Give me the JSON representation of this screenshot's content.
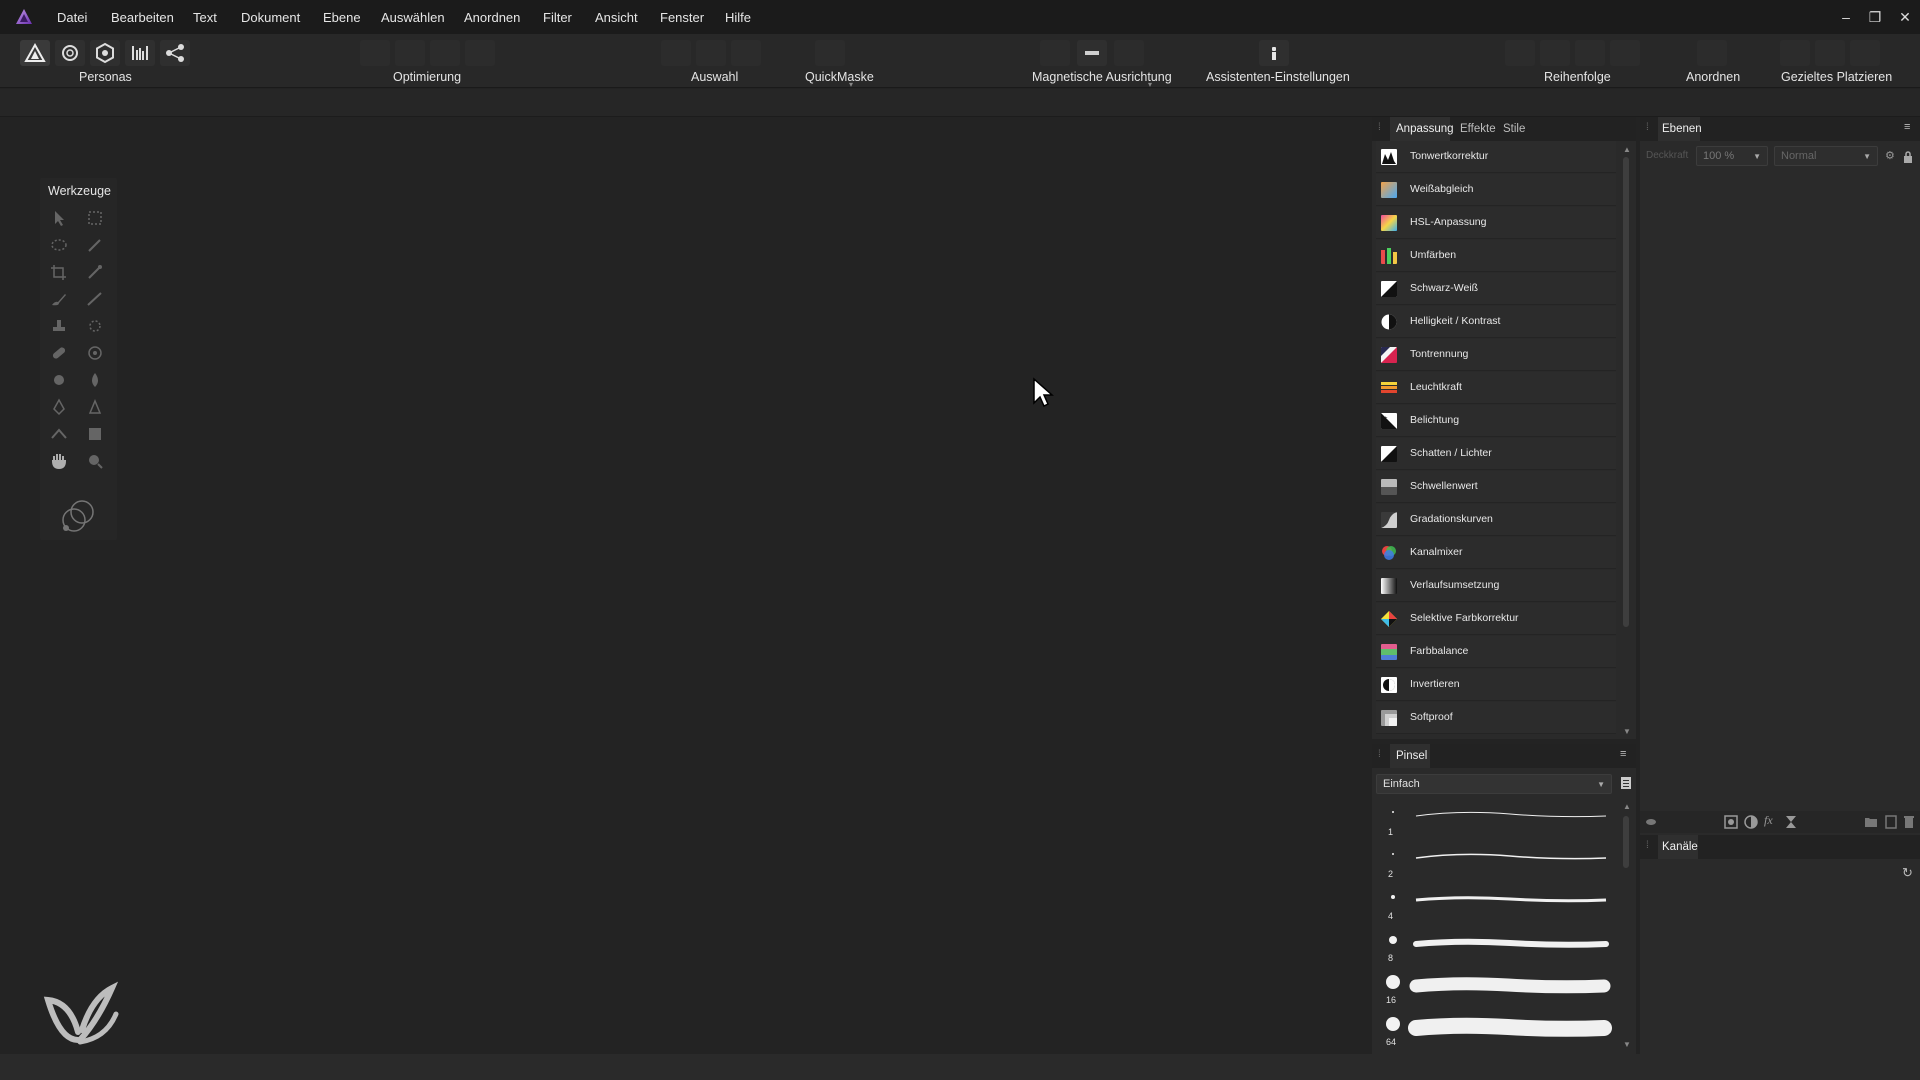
{
  "menubar": {
    "items": [
      "Datei",
      "Bearbeiten",
      "Text",
      "Dokument",
      "Ebene",
      "Auswählen",
      "Anordnen",
      "Filter",
      "Ansicht",
      "Fenster",
      "Hilfe"
    ],
    "window_controls": {
      "minimize": "–",
      "restore": "❐",
      "close": "✕"
    }
  },
  "toolbar": {
    "groups": [
      "Personas",
      "Optimierung",
      "Auswahl",
      "QuickMaske",
      "Magnetische Ausrichtung",
      "Assistenten-Einstellungen",
      "Reihenfolge",
      "Anordnen",
      "Gezieltes Platzieren"
    ]
  },
  "tools_panel": {
    "title": "Werkzeuge"
  },
  "adjustments_panel": {
    "tabs": [
      "Anpassung",
      "Effekte",
      "Stile"
    ],
    "items": [
      {
        "label": "Tonwertkorrektur",
        "icon": "levels-icon"
      },
      {
        "label": "Weißabgleich",
        "icon": "white-balance-icon"
      },
      {
        "label": "HSL-Anpassung",
        "icon": "hsl-icon"
      },
      {
        "label": "Umfärben",
        "icon": "recolor-icon"
      },
      {
        "label": "Schwarz-Weiß",
        "icon": "black-white-icon"
      },
      {
        "label": "Helligkeit / Kontrast",
        "icon": "brightness-contrast-icon"
      },
      {
        "label": "Tontrennung",
        "icon": "posterize-icon"
      },
      {
        "label": "Leuchtkraft",
        "icon": "vibrance-icon"
      },
      {
        "label": "Belichtung",
        "icon": "exposure-icon"
      },
      {
        "label": "Schatten / Lichter",
        "icon": "shadows-highlights-icon"
      },
      {
        "label": "Schwellenwert",
        "icon": "threshold-icon"
      },
      {
        "label": "Gradationskurven",
        "icon": "curves-icon"
      },
      {
        "label": "Kanalmixer",
        "icon": "channel-mixer-icon"
      },
      {
        "label": "Verlaufsumsetzung",
        "icon": "gradient-map-icon"
      },
      {
        "label": "Selektive Farbkorrektur",
        "icon": "selective-color-icon"
      },
      {
        "label": "Farbbalance",
        "icon": "color-balance-icon"
      },
      {
        "label": "Invertieren",
        "icon": "invert-icon"
      },
      {
        "label": "Softproof",
        "icon": "soft-proof-icon"
      }
    ]
  },
  "layers_panel": {
    "tab": "Ebenen",
    "opacity_label": "Deckkraft",
    "opacity_value": "100 %",
    "blend_mode": "Normal",
    "channels_tab": "Kanäle"
  },
  "brushes_panel": {
    "tab": "Pinsel",
    "category": "Einfach",
    "sizes": [
      "1",
      "2",
      "4",
      "8",
      "16",
      "64"
    ]
  },
  "colors": {
    "accent": "#7b3fbf",
    "background": "#232323"
  }
}
